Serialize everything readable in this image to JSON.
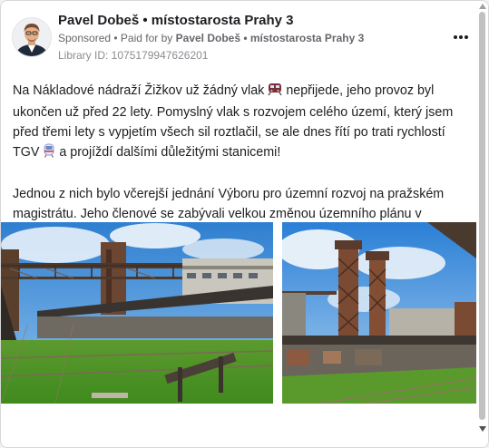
{
  "ad": {
    "page_name": "Pavel Dobeš • místostarosta Prahy 3",
    "sponsored_label": "Sponsored",
    "paid_for_prefix": "• Paid for by",
    "paid_for_name": "Pavel Dobeš • místostarosta Prahy 3",
    "library_id": "Library ID: 1075179947626201",
    "more_icon": "more-options-icon"
  },
  "body": {
    "p1_part1": "Na Nákladové nádraží Žižkov už žádný vlak",
    "p1_emoji1": "train-icon",
    "p1_part2": "nepřijede, jeho provoz byl ukončen už před 22 lety. Pomyslný vlak s rozvojem celého území, který jsem před třemi lety s vypjetím všech sil roztlačil, se ale dnes řítí po trati rychlostí TGV",
    "p1_emoji2": "high-speed-train-icon",
    "p1_part3": "a projíždí dalšími důležitými stanicemi!",
    "p2": "Jednou z nich bylo včerejší jednání Výboru pro územní rozvoj na pražském magistrátu. Jeho členové se zabývali velkou změnou územního plánu v lokalitě…"
  },
  "carousel": {
    "images": [
      "railway-station-platform-photo",
      "railway-towers-photo"
    ],
    "next_icon": "chevron-right-icon"
  },
  "colors": {
    "text": "#1c1e21",
    "secondary": "#65676b",
    "sky": "#3a8fd9",
    "grass": "#4f9e2a"
  }
}
